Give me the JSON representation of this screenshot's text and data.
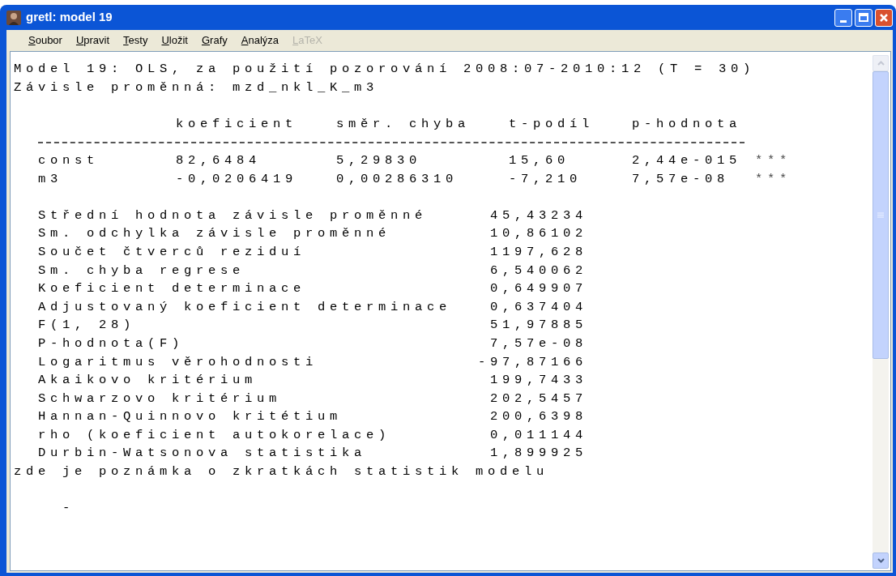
{
  "window": {
    "title": "gretl: model 19"
  },
  "menu": [
    {
      "label": "Soubor",
      "disabled": false
    },
    {
      "label": "Upravit",
      "disabled": false
    },
    {
      "label": "Testy",
      "disabled": false
    },
    {
      "label": "Uložit",
      "disabled": false
    },
    {
      "label": "Grafy",
      "disabled": false
    },
    {
      "label": "Analýza",
      "disabled": false
    },
    {
      "label": "LaTeX",
      "disabled": true
    }
  ],
  "output": {
    "heading": [
      "Model 19: OLS, za použití pozorování 2008:07-2010:12 (T = 30)",
      "Závisle proměnná: mzd_nkl_K_m3"
    ],
    "table": {
      "columns": [
        "koeficient",
        "směr. chyba",
        "t-podíl",
        "p-hodnota"
      ],
      "rows": [
        {
          "name": "const",
          "values": [
            "82,6484",
            "5,29830",
            "15,60",
            "2,44e-015"
          ],
          "stars": "***"
        },
        {
          "name": "m3",
          "values": [
            "-0,0206419",
            "0,00286310",
            "-7,210",
            "7,57e-08"
          ],
          "stars": "***"
        }
      ]
    },
    "stats": [
      {
        "label": "Střední hodnota závisle proměnné",
        "value": "45,43234"
      },
      {
        "label": "Sm. odchylka závisle proměnné",
        "value": "10,86102"
      },
      {
        "label": "Součet čtverců reziduí",
        "value": "1197,628"
      },
      {
        "label": "Sm. chyba regrese",
        "value": "6,540062"
      },
      {
        "label": "Koeficient determinace",
        "value": "0,649907"
      },
      {
        "label": "Adjustovaný koeficient determinace",
        "value": "0,637404"
      },
      {
        "label": "F(1, 28)",
        "value": "51,97885"
      },
      {
        "label": "P-hodnota(F)",
        "value": "7,57e-08"
      },
      {
        "label": "Logaritmus věrohodnosti",
        "value": "-97,87166"
      },
      {
        "label": "Akaikovo kritérium",
        "value": "199,7433"
      },
      {
        "label": "Schwarzovo kritérium",
        "value": "202,5457"
      },
      {
        "label": "Hannan-Quinnovo kritétium",
        "value": "200,6398"
      },
      {
        "label": "rho (koeficient autokorelace)",
        "value": "0,011144"
      },
      {
        "label": "Durbin-Watsonova statistika",
        "value": "1,899925"
      }
    ],
    "note": "zde je poznámka o zkratkách statistik modelu",
    "trailing": "-"
  }
}
